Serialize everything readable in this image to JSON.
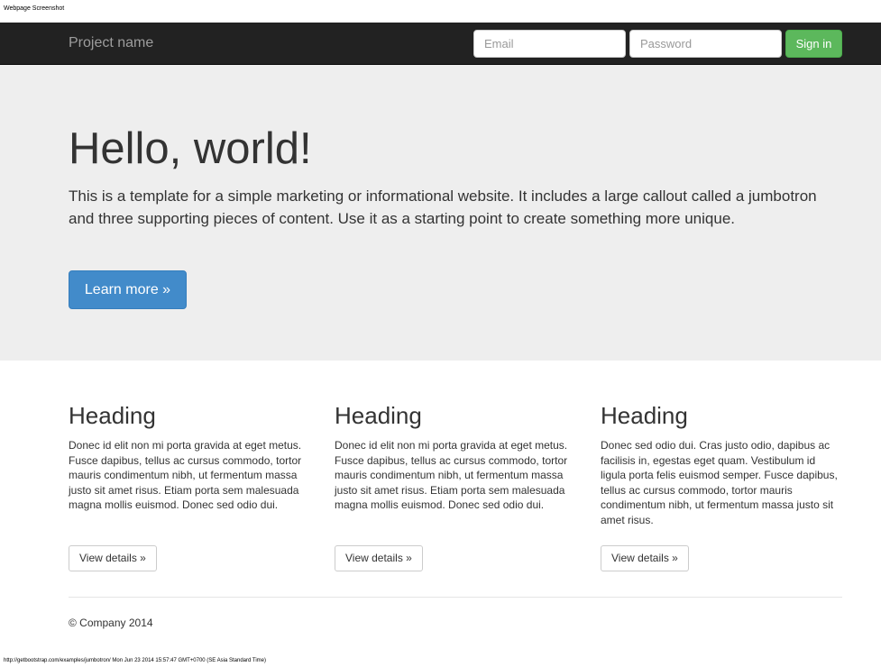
{
  "print_header": "Webpage Screenshot",
  "navbar": {
    "brand": "Project name",
    "email_placeholder": "Email",
    "password_placeholder": "Password",
    "signin_label": "Sign in",
    "bg_color": "#222222",
    "signin_color": "#5cb85c"
  },
  "jumbotron": {
    "title": "Hello, world!",
    "text": "This is a template for a simple marketing or informational website. It includes a large callout called a jumbotron and three supporting pieces of content. Use it as a starting point to create something more unique.",
    "button_label": "Learn more »",
    "bg_color": "#eeeeee",
    "button_color": "#428bca"
  },
  "columns": [
    {
      "heading": "Heading",
      "text": "Donec id elit non mi porta gravida at eget metus. Fusce dapibus, tellus ac cursus commodo, tortor mauris condimentum nibh, ut fermentum massa justo sit amet risus. Etiam porta sem malesuada magna mollis euismod. Donec sed odio dui.",
      "button_label": "View details »"
    },
    {
      "heading": "Heading",
      "text": "Donec id elit non mi porta gravida at eget metus. Fusce dapibus, tellus ac cursus commodo, tortor mauris condimentum nibh, ut fermentum massa justo sit amet risus. Etiam porta sem malesuada magna mollis euismod. Donec sed odio dui.",
      "button_label": "View details »"
    },
    {
      "heading": "Heading",
      "text": "Donec sed odio dui. Cras justo odio, dapibus ac facilisis in, egestas eget quam. Vestibulum id ligula porta felis euismod semper. Fusce dapibus, tellus ac cursus commodo, tortor mauris condimentum nibh, ut fermentum massa justo sit amet risus.",
      "button_label": "View details »"
    }
  ],
  "footer": {
    "text": "© Company 2014"
  },
  "print_footer": "http://getbootstrap.com/examples/jumbotron/ Mon Jun 23 2014 15:57:47 GMT+0700 (SE Asia Standard Time)"
}
